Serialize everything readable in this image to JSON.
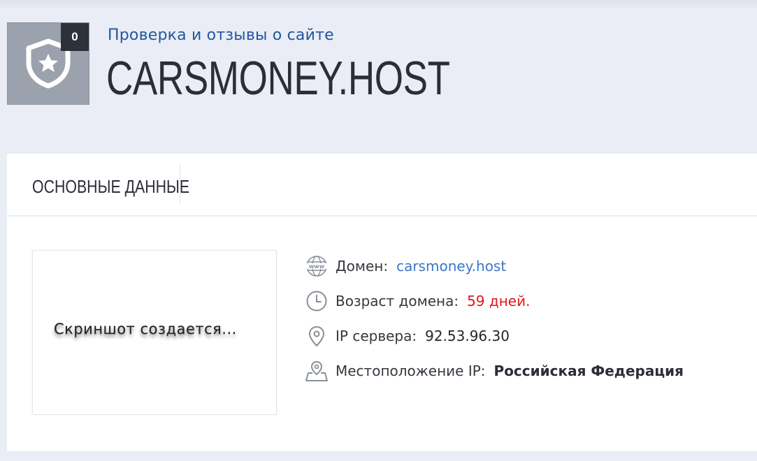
{
  "header": {
    "subtitle": "Проверка и отзывы о сайте",
    "title": "CARSMONEY.HOST",
    "badge_count": "0",
    "logo_icon": "shield-star-icon"
  },
  "tabs": [
    {
      "label": "ОСНОВНЫЕ ДАННЫЕ"
    }
  ],
  "screenshot": {
    "placeholder_text": "Скриншот  создается..."
  },
  "info": {
    "domain": {
      "icon": "www-globe-icon",
      "label": "Домен:",
      "value": "carsmoney.host"
    },
    "age": {
      "icon": "clock-icon",
      "label": "Возраст домена:",
      "value": "59 дней."
    },
    "ip": {
      "icon": "location-pin-icon",
      "label": "IP сервера:",
      "value": "92.53.96.30"
    },
    "location": {
      "icon": "map-pin-icon",
      "label": "Местоположение IP:",
      "value": "Российская Федерация"
    }
  },
  "colors": {
    "background": "#eaedf5",
    "subtitle": "#23569c",
    "link": "#3a78c6",
    "warning": "#e01818",
    "logo_bg": "#9ca2ad",
    "badge_bg": "#2c313a"
  }
}
